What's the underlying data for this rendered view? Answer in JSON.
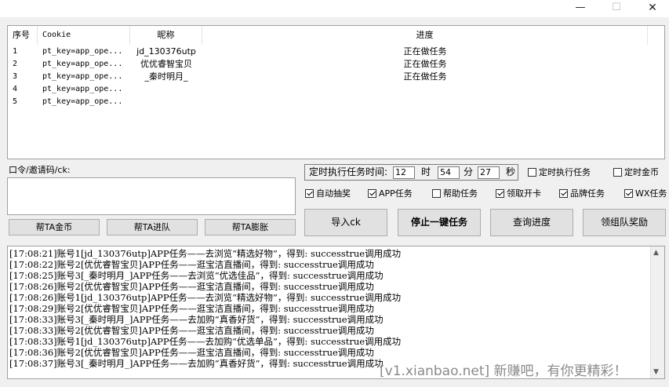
{
  "window": {
    "minimize_glyph": "—",
    "maximize_glyph": "☐",
    "close_glyph": "✕"
  },
  "table": {
    "headers": [
      "序号",
      "Cookie",
      "昵称",
      "进度"
    ],
    "rows": [
      {
        "index": "1",
        "cookie": "pt_key=app_ope...",
        "nickname": "jd_130376utp",
        "progress": "正在做任务"
      },
      {
        "index": "2",
        "cookie": "pt_key=app_ope...",
        "nickname": "优优睿智宝贝",
        "progress": "正在做任务"
      },
      {
        "index": "3",
        "cookie": "pt_key=app_ope...",
        "nickname": "_秦时明月_",
        "progress": "正在做任务"
      },
      {
        "index": "4",
        "cookie": "pt_key=app_ope...",
        "nickname": "",
        "progress": ""
      },
      {
        "index": "5",
        "cookie": "pt_key=app_ope...",
        "nickname": "",
        "progress": ""
      }
    ]
  },
  "code_label": "口令/邀请码/ck:",
  "code_value": "",
  "help_buttons": [
    "帮TA金币",
    "帮TA进队",
    "帮TA膨胀"
  ],
  "timer": {
    "label": "定时执行任务时间:",
    "hour": "12",
    "hour_unit": "时",
    "minute": "54",
    "minute_unit": "分",
    "second": "27",
    "second_unit": "秒"
  },
  "options_row1": [
    {
      "label": "定时执行任务",
      "checked": false
    },
    {
      "label": "定时金币",
      "checked": false
    }
  ],
  "options_row2": [
    {
      "label": "自动抽奖",
      "checked": true
    },
    {
      "label": "APP任务",
      "checked": true
    },
    {
      "label": "帮助任务",
      "checked": false
    },
    {
      "label": "领取开卡",
      "checked": true
    },
    {
      "label": "品牌任务",
      "checked": true
    },
    {
      "label": "WX任务",
      "checked": true
    }
  ],
  "action_buttons": [
    "导入ck",
    "停止一键任务",
    "查询进度",
    "领组队奖励"
  ],
  "log": [
    "[17:08:21]账号1[jd_130376utp]APP任务——去浏览“精选好物”，得到: successtrue调用成功",
    "[17:08:22]账号2[优优睿智宝贝]APP任务——逛宝洁直播间，得到: successtrue调用成功",
    "[17:08:25]账号3[_秦时明月_]APP任务——去浏览“优选佳品”，得到: successtrue调用成功",
    "[17:08:26]账号2[优优睿智宝贝]APP任务——逛宝洁直播间，得到: successtrue调用成功",
    "[17:08:26]账号1[jd_130376utp]APP任务——去浏览“精选好物”，得到: successtrue调用成功",
    "[17:08:29]账号2[优优睿智宝贝]APP任务——逛宝洁直播间，得到: successtrue调用成功",
    "[17:08:33]账号3[_秦时明月_]APP任务——去加购“真香好货”，得到: successtrue调用成功",
    "[17:08:33]账号2[优优睿智宝贝]APP任务——逛宝洁直播间，得到: successtrue调用成功",
    "[17:08:33]账号1[jd_130376utp]APP任务——去加购“优选单品”，得到: successtrue调用成功",
    "[17:08:36]账号2[优优睿智宝贝]APP任务——逛宝洁直播间，得到: successtrue调用成功",
    "[17:08:37]账号3[_秦时明月_]APP任务——去加购“真香好货”，得到: successtrue调用成功"
  ],
  "watermark": "[v1.xianbao.net] 新赚吧，有你更精彩！",
  "icons": {
    "scroll_up": "scroll-up-arrow-icon",
    "scroll_down": "scroll-down-arrow-icon"
  }
}
